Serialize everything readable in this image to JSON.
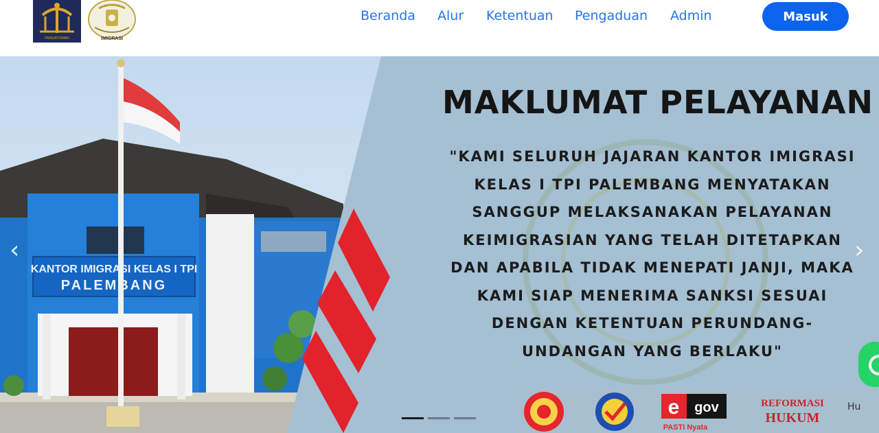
{
  "header": {
    "logo_left_icon": "pengayoman-logo-icon",
    "logo_left_caption": "PENGAYOMAN",
    "logo_right_icon": "imigrasi-logo-icon",
    "logo_right_caption": "IMIGRASI",
    "nav": [
      {
        "label": "Beranda"
      },
      {
        "label": "Alur"
      },
      {
        "label": "Ketentuan"
      },
      {
        "label": "Pengaduan"
      },
      {
        "label": "Admin"
      }
    ],
    "login_label": "Masuk",
    "accent_color": "#0b64ee",
    "nav_color": "#2a74e2"
  },
  "hero": {
    "building_sign_line1": "KANTOR IMIGRASI KELAS I TPI",
    "building_sign_line2": "PALEMBANG",
    "headline": "MAKLUMAT PELAYANAN",
    "statement_lines": [
      "\"KAMI SELURUH JAJARAN KANTOR IMIGRASI",
      "KELAS I TPI PALEMBANG MENYATAKAN",
      "SANGGUP MELAKSANAKAN PELAYANAN",
      "KEIMIGRASIAN YANG TELAH DITETAPKAN",
      "DAN APABILA TIDAK MENEPATI JANJI, MAKA",
      "KAMI SIAP MENERIMA SANKSI SESUAI",
      "DENGAN KETENTUAN PERUNDANG-",
      "UNDANGAN YANG BERLAKU\""
    ],
    "prev_icon": "chevron-left-icon",
    "next_icon": "chevron-right-icon",
    "prev_glyph": "‹",
    "next_glyph": "›",
    "slide_indicators": [
      {
        "active": true
      },
      {
        "active": false
      },
      {
        "active": false
      }
    ],
    "footer_logos": {
      "egov_e": "e",
      "egov_gov": "gov",
      "egov_sub": "PASTI Nyata",
      "reformasi_line1": "REFORMASI",
      "reformasi_line2": "HUKUM"
    },
    "whatsapp_icon": "whatsapp-icon",
    "help_text": "Hu"
  }
}
